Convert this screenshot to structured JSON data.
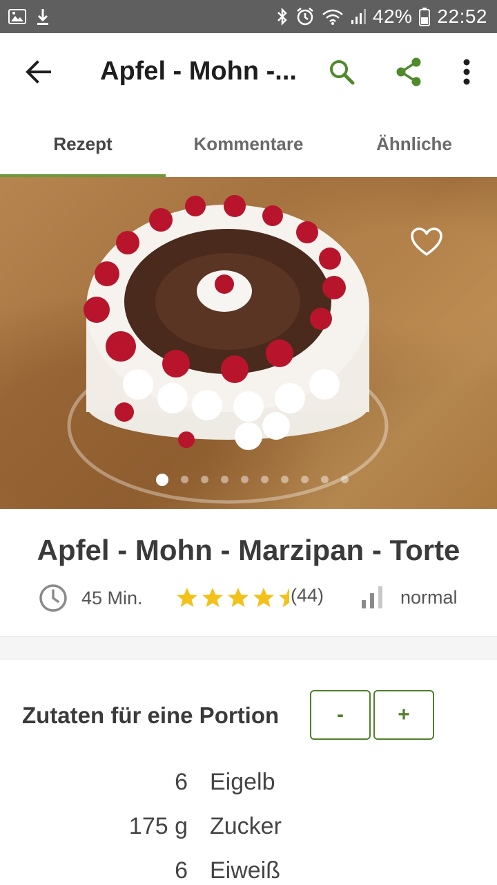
{
  "status_bar": {
    "battery": "42%",
    "time": "22:52"
  },
  "app_bar": {
    "title": "Apfel - Mohn -..."
  },
  "tabs": [
    {
      "label": "Rezept",
      "active": true
    },
    {
      "label": "Kommentare",
      "active": false
    },
    {
      "label": "Ähnliche",
      "active": false
    }
  ],
  "gallery": {
    "total_images": 10,
    "current_index": 1
  },
  "recipe": {
    "title": "Apfel - Mohn - Marzipan - Torte",
    "time": "45 Min.",
    "rating": 4.5,
    "rating_count": "(44)",
    "difficulty": "normal"
  },
  "ingredients": {
    "heading": "Zutaten für eine Portion",
    "minus_label": "-",
    "plus_label": "+",
    "items": [
      {
        "qty": "6",
        "name": "Eigelb"
      },
      {
        "qty": "175 g",
        "name": "Zucker"
      },
      {
        "qty": "6",
        "name": "Eiweiß"
      }
    ]
  },
  "colors": {
    "accent": "#4f7f2b",
    "star": "#f2c21a",
    "status_bar": "#5f5f5f"
  }
}
